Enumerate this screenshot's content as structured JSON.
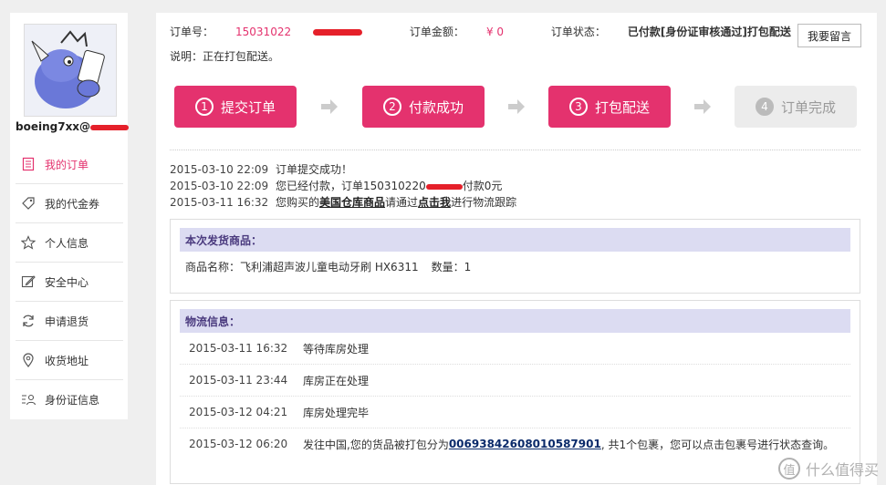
{
  "sidebar": {
    "username": "boeing7xx@",
    "username_suffix": ".",
    "items": [
      {
        "label": "我的订单",
        "icon": "order-list-icon"
      },
      {
        "label": "我的代金券",
        "icon": "coupon-tag-icon"
      },
      {
        "label": "个人信息",
        "icon": "star-icon"
      },
      {
        "label": "安全中心",
        "icon": "edit-pen-icon"
      },
      {
        "label": "申请退货",
        "icon": "refresh-icon"
      },
      {
        "label": "收货地址",
        "icon": "location-pin-icon"
      },
      {
        "label": "身份证信息",
        "icon": "id-card-icon"
      }
    ]
  },
  "order": {
    "no_label": "订单号：",
    "no_value": "15031022",
    "amount_label": "订单金额：",
    "amount_value": "¥ 0",
    "status_label": "订单状态：",
    "status_value": "已付款[身份证审核通过]打包配送",
    "note": "说明：正在打包配送。",
    "message_button": "我要留言"
  },
  "steps": [
    {
      "num": "1",
      "label": "提交订单",
      "active": true
    },
    {
      "num": "2",
      "label": "付款成功",
      "active": true
    },
    {
      "num": "3",
      "label": "打包配送",
      "active": true
    },
    {
      "num": "4",
      "label": "订单完成",
      "active": false
    }
  ],
  "log": [
    {
      "time": "2015-03-10 22:09",
      "text": "订单提交成功！"
    },
    {
      "time": "2015-03-10 22:09",
      "text_a": "您已经付款，订单150310220",
      "text_b": "付款0元"
    },
    {
      "time": "2015-03-11 16:32",
      "text_a": "您购买的",
      "link1": "美国仓库商品",
      "text_b": "请通过",
      "link2": "点击我",
      "text_c": "进行物流跟踪"
    }
  ],
  "shipment_box": {
    "title": "本次发货商品：",
    "product_label": "商品名称：飞利浦超声波儿童电动牙刷 HX6311",
    "qty_label": "数量：1"
  },
  "logistics_box": {
    "title": "物流信息：",
    "rows": [
      {
        "time": "2015-03-11 16:32",
        "text": "等待库房处理"
      },
      {
        "time": "2015-03-11 23:44",
        "text": "库房正在处理"
      },
      {
        "time": "2015-03-12 04:21",
        "text": "库房处理完毕"
      },
      {
        "time": "2015-03-12 06:20",
        "text_a": "发往中国,您的货品被打包分为",
        "link": "006938426080105879​01",
        "text_b": ", 共1个包裹，您可以点击包裹号进行状态查询。"
      }
    ]
  },
  "watermark": {
    "glyph": "值",
    "text": "什么值得买"
  },
  "colors": {
    "accent": "#e4326e",
    "box_title_bg": "#dcdcf2",
    "redaction": "#e5202a"
  }
}
